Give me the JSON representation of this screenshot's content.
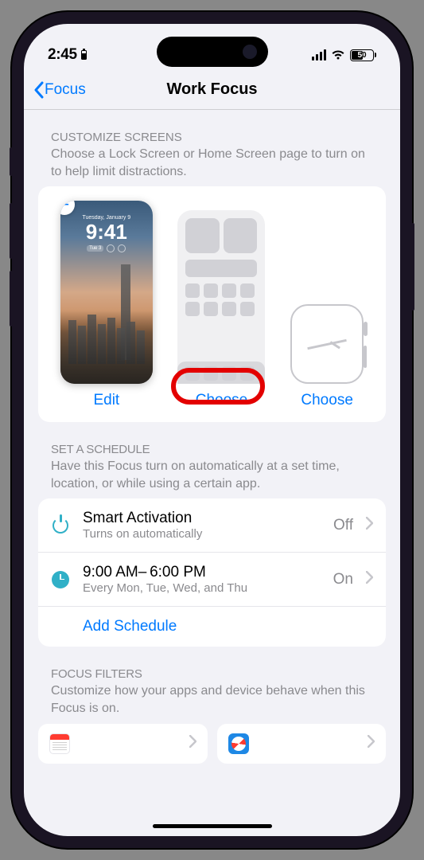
{
  "status_bar": {
    "time": "2:45",
    "battery_pct": "50"
  },
  "nav": {
    "back_label": "Focus",
    "title": "Work Focus"
  },
  "customize": {
    "header": "Customize Screens",
    "desc": "Choose a Lock Screen or Home Screen page to turn on to help limit distractions.",
    "lock_screen": {
      "date": "Tuesday, January 9",
      "time": "9:41",
      "action": "Edit"
    },
    "home_screen": {
      "action": "Choose"
    },
    "watch": {
      "action": "Choose"
    }
  },
  "schedule": {
    "header": "Set a Schedule",
    "desc": "Have this Focus turn on automatically at a set time, location, or while using a certain app.",
    "rows": [
      {
        "title": "Smart Activation",
        "sub": "Turns on automatically",
        "value": "Off"
      },
      {
        "title": "9:00 AM– 6:00 PM",
        "sub": "Every Mon, Tue, Wed, and Thu",
        "value": "On"
      }
    ],
    "add_label": "Add Schedule"
  },
  "filters": {
    "header": "Focus Filters",
    "desc": "Customize how your apps and device behave when this Focus is on."
  }
}
